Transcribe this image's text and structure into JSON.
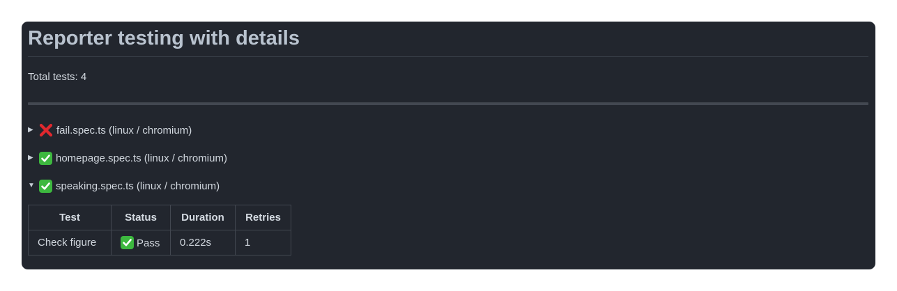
{
  "page": {
    "title": "Reporter testing with details",
    "total_tests": "Total tests: 4"
  },
  "specs": [
    {
      "label": "fail.spec.ts (linux / chromium)",
      "status": "fail",
      "expanded": false,
      "arrow": "▶",
      "icon": "red-cross-icon"
    },
    {
      "label": "homepage.spec.ts (linux / chromium)",
      "status": "pass",
      "expanded": false,
      "arrow": "▶",
      "icon": "green-check-icon"
    },
    {
      "label": "speaking.spec.ts (linux / chromium)",
      "status": "pass",
      "expanded": true,
      "arrow": "▼",
      "icon": "green-check-icon"
    }
  ],
  "results_table": {
    "headers": [
      "Test",
      "Status",
      "Duration",
      "Retries"
    ],
    "rows": [
      {
        "test": "Check figure",
        "status": "Pass",
        "duration": "0.222s",
        "retries": "1"
      }
    ]
  },
  "colors": {
    "card_bg": "#22262e",
    "pass_green": "#3db83f",
    "fail_red": "#e0282e"
  }
}
